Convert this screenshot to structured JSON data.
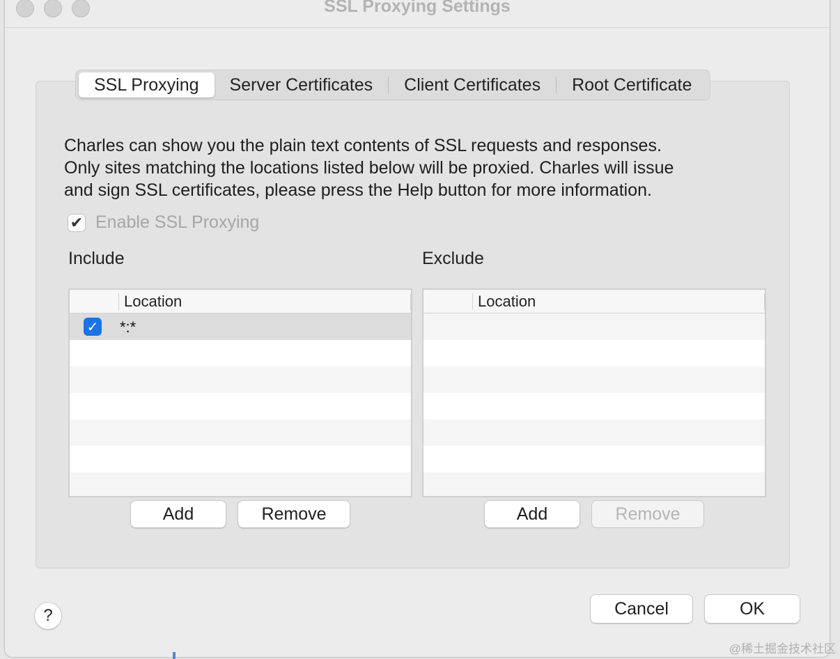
{
  "window": {
    "title": "SSL Proxying Settings"
  },
  "tabs": [
    {
      "label": "SSL Proxying",
      "active": true
    },
    {
      "label": "Server Certificates",
      "active": false
    },
    {
      "label": "Client Certificates",
      "active": false
    },
    {
      "label": "Root Certificate",
      "active": false
    }
  ],
  "description": {
    "line1": "Charles can show you the plain text contents of SSL requests and responses.",
    "line2": "Only sites matching the locations listed below will be proxied. Charles will issue",
    "line3": "and sign SSL certificates, please press the Help button for more information."
  },
  "enable_ssl": {
    "label": "Enable SSL Proxying",
    "checked": true,
    "disabled": true
  },
  "include": {
    "label": "Include",
    "column_header": "Location",
    "rows": [
      {
        "enabled": true,
        "location": "*:*"
      }
    ],
    "add_label": "Add",
    "remove_label": "Remove"
  },
  "exclude": {
    "label": "Exclude",
    "column_header": "Location",
    "rows": [],
    "add_label": "Add",
    "remove_label": "Remove"
  },
  "footer": {
    "help_label": "?",
    "cancel_label": "Cancel",
    "ok_label": "OK"
  },
  "watermark": "@稀土掘金技术社区",
  "colors": {
    "accent": "#1a73e8",
    "window_bg": "#ececec",
    "panel_bg": "#e3e3e3"
  }
}
